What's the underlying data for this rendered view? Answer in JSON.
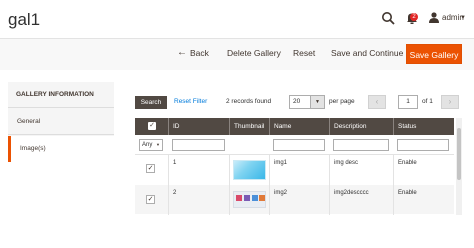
{
  "header": {
    "page_title": "gal1",
    "notifications_count": "2",
    "user_name": "admin"
  },
  "actions": {
    "back": "Back",
    "delete_gallery": "Delete Gallery",
    "reset": "Reset",
    "save_continue": "Save and Continue",
    "save_gallery": "Save Gallery"
  },
  "sidebar": {
    "title": "GALLERY INFORMATION",
    "items": [
      {
        "label": "General"
      },
      {
        "label": "Image(s)"
      }
    ]
  },
  "grid": {
    "search_button": "Search",
    "reset_filter": "Reset Filter",
    "records_found": "2 records found",
    "per_page_value": "20",
    "per_page_label": "per page",
    "current_page": "1",
    "page_of": "of 1",
    "columns": [
      "ID",
      "Thumbnail",
      "Name",
      "Description",
      "Status"
    ],
    "filter_any": "Any",
    "rows": [
      {
        "id": "1",
        "name": "img1",
        "description": "img desc",
        "status": "Enable"
      },
      {
        "id": "2",
        "name": "img2",
        "description": "img2descccc",
        "status": "Enable"
      }
    ]
  },
  "colors": {
    "accent": "#eb5202",
    "grid_header": "#514943",
    "link": "#007bdb"
  }
}
